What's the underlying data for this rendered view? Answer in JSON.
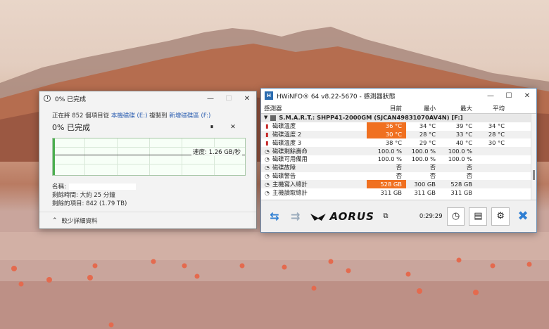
{
  "copy_dialog": {
    "title": "0% 已完成",
    "line1_prefix": "正在將 852 個項目從",
    "source": "本機磁碟 (E:)",
    "line1_middle": "複製到",
    "destination": "新增磁碟區 (F:)",
    "percent_text": "0% 已完成",
    "pause_label": "⏸",
    "stop_label": "✕",
    "speed": "速度: 1.26 GB/秒",
    "progress_fraction": 0.01,
    "name_label": "名稱:",
    "time_left": "剩餘時間: 大約 25 分鐘",
    "items_left": "剩餘的項目: 842 (1.79 TB)",
    "less_details": "較少詳細資料",
    "minimize": "—",
    "maximize": "☐",
    "close": "✕"
  },
  "hwinfo": {
    "title": "HWiNFO® 64 v8.22-5670 - 感測器狀態",
    "logo": "H",
    "minimize": "—",
    "maximize": "☐",
    "close": "✕",
    "columns": [
      "感測器",
      "目前",
      "最小",
      "最大",
      "平均"
    ],
    "group": "S.M.A.R.T.: SHPP41-2000GM (SJCAN49831070AV4N) [F:]",
    "rows": [
      {
        "icon": "therm",
        "name": "磁碟溫度",
        "cur": "36 °C",
        "min": "34 °C",
        "max": "39 °C",
        "avg": "34 °C",
        "hl": true
      },
      {
        "icon": "therm",
        "name": "磁碟溫度 2",
        "cur": "30 °C",
        "min": "28 °C",
        "max": "33 °C",
        "avg": "28 °C",
        "hl": true
      },
      {
        "icon": "therm",
        "name": "磁碟溫度 3",
        "cur": "38 °C",
        "min": "29 °C",
        "max": "40 °C",
        "avg": "30 °C",
        "hl": false
      },
      {
        "icon": "clock",
        "name": "磁碟剩餘壽命",
        "cur": "100.0 %",
        "min": "100.0 %",
        "max": "100.0 %",
        "avg": "",
        "hl": false
      },
      {
        "icon": "clock",
        "name": "磁碟可用備用",
        "cur": "100.0 %",
        "min": "100.0 %",
        "max": "100.0 %",
        "avg": "",
        "hl": false
      },
      {
        "icon": "clock",
        "name": "磁碟故障",
        "cur": "否",
        "min": "否",
        "max": "否",
        "avg": "",
        "hl": false
      },
      {
        "icon": "clock",
        "name": "磁碟警告",
        "cur": "否",
        "min": "否",
        "max": "否",
        "avg": "",
        "hl": false
      },
      {
        "icon": "clock",
        "name": "主機寫入總計",
        "cur": "528 GB",
        "min": "300 GB",
        "max": "528 GB",
        "avg": "",
        "hl": true
      },
      {
        "icon": "clock",
        "name": "主機讀取總計",
        "cur": "311 GB",
        "min": "311 GB",
        "max": "311 GB",
        "avg": "",
        "hl": false
      }
    ],
    "brand": "AORUS",
    "elapsed": "0:29:29",
    "icons": {
      "left": "arrow-left-icon",
      "right": "arrow-right-icon",
      "clock": "clock-icon",
      "report": "report-icon",
      "settings": "gear-icon",
      "close": "close-icon"
    },
    "accent": "#f07020"
  }
}
